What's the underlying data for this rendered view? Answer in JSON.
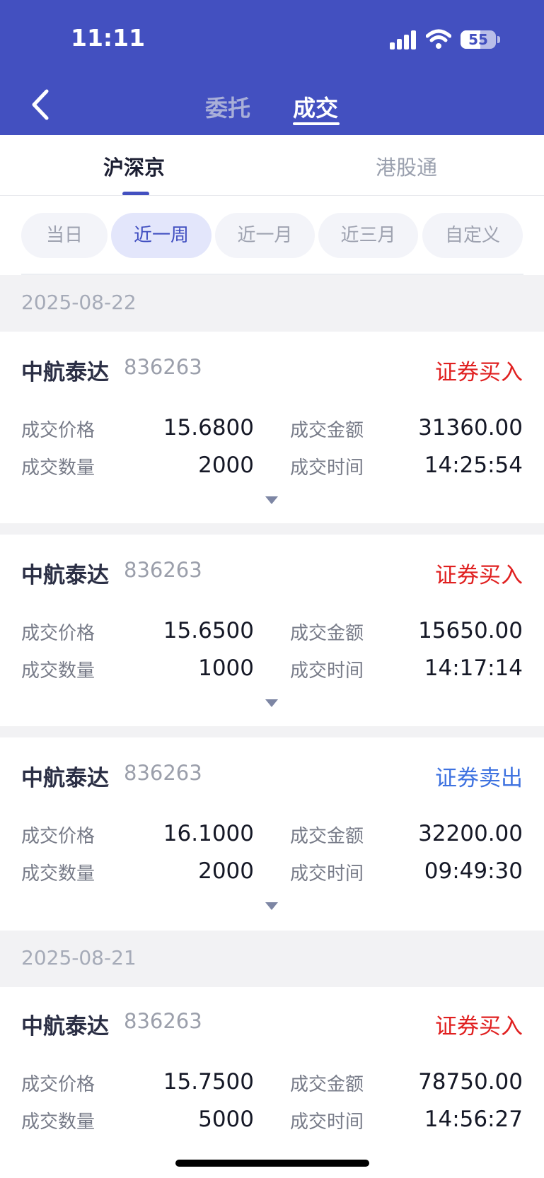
{
  "status_bar": {
    "time": "11:11",
    "battery": "55"
  },
  "header": {
    "tabs": [
      {
        "label": "委托",
        "active": false
      },
      {
        "label": "成交",
        "active": true
      }
    ]
  },
  "market_tabs": [
    {
      "label": "沪深京",
      "active": true
    },
    {
      "label": "港股通",
      "active": false
    }
  ],
  "filters": [
    {
      "label": "当日",
      "active": false
    },
    {
      "label": "近一周",
      "active": true
    },
    {
      "label": "近一月",
      "active": false
    },
    {
      "label": "近三月",
      "active": false
    },
    {
      "label": "自定义",
      "active": false
    }
  ],
  "field_labels": {
    "price": "成交价格",
    "amount": "成交金额",
    "quantity": "成交数量",
    "time": "成交时间"
  },
  "colors": {
    "accent": "#4350c0",
    "buy": "#e02020",
    "sell": "#3e72e0"
  },
  "groups": [
    {
      "date": "2025-08-22",
      "trades": [
        {
          "name": "中航泰达",
          "code": "836263",
          "type": "证券买入",
          "side": "buy",
          "price": "15.6800",
          "amount": "31360.00",
          "quantity": "2000",
          "time": "14:25:54"
        },
        {
          "name": "中航泰达",
          "code": "836263",
          "type": "证券买入",
          "side": "buy",
          "price": "15.6500",
          "amount": "15650.00",
          "quantity": "1000",
          "time": "14:17:14"
        },
        {
          "name": "中航泰达",
          "code": "836263",
          "type": "证券卖出",
          "side": "sell",
          "price": "16.1000",
          "amount": "32200.00",
          "quantity": "2000",
          "time": "09:49:30"
        }
      ]
    },
    {
      "date": "2025-08-21",
      "trades": [
        {
          "name": "中航泰达",
          "code": "836263",
          "type": "证券买入",
          "side": "buy",
          "price": "15.7500",
          "amount": "78750.00",
          "quantity": "5000",
          "time": "14:56:27"
        }
      ]
    }
  ]
}
